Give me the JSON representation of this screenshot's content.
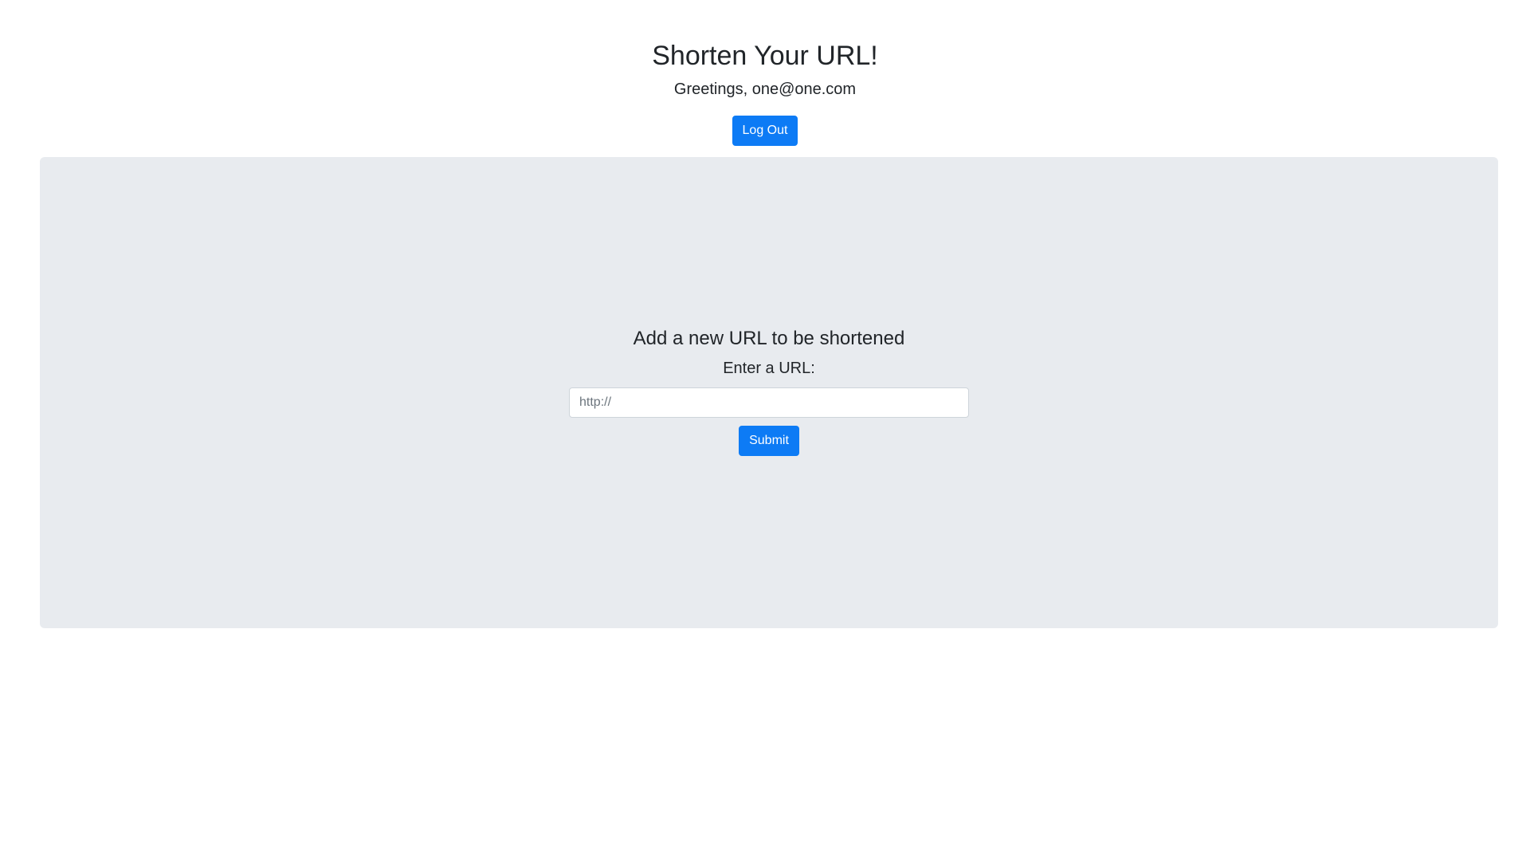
{
  "header": {
    "title": "Shorten Your URL!",
    "greeting": "Greetings, one@one.com",
    "logout_label": "Log Out"
  },
  "form": {
    "title": "Add a new URL to be shortened",
    "field_label": "Enter a URL:",
    "url_placeholder": "http://",
    "url_value": "",
    "submit_label": "Submit"
  },
  "colors": {
    "primary": "#0d7bf5",
    "panel_background": "#e8ebef",
    "text": "#212529"
  }
}
